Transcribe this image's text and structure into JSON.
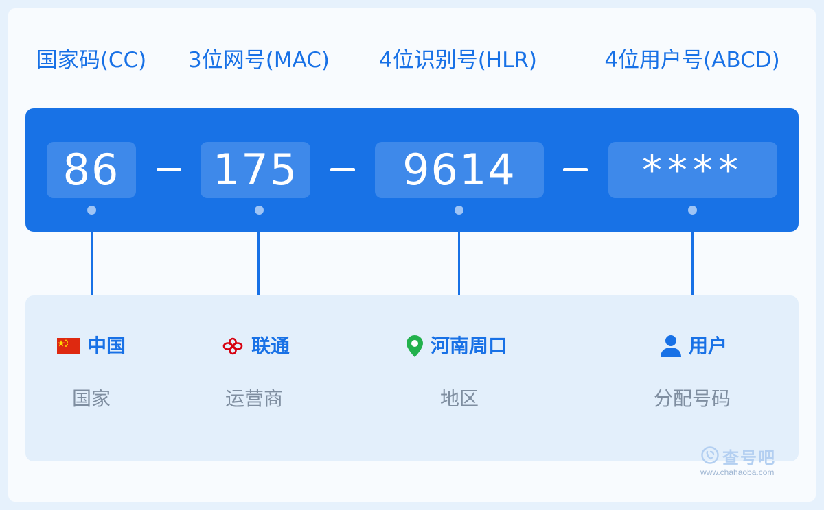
{
  "segments": [
    {
      "label": "国家码(CC)",
      "value": "86"
    },
    {
      "label": "3位网号(MAC)",
      "value": "175"
    },
    {
      "label": "4位识别号(HLR)",
      "value": "9614"
    },
    {
      "label": "4位用户号(ABCD)",
      "value": "****"
    }
  ],
  "details": [
    {
      "name": "中国",
      "caption": "国家",
      "icon": "china-flag-icon"
    },
    {
      "name": "联通",
      "caption": "运营商",
      "icon": "china-unicom-logo-icon"
    },
    {
      "name": "河南周口",
      "caption": "地区",
      "icon": "location-pin-icon"
    },
    {
      "name": "用户",
      "caption": "分配号码",
      "icon": "user-icon"
    }
  ],
  "watermark": {
    "title": "查号吧",
    "url": "www.chahaoba.com",
    "icon": "phone-search-icon"
  },
  "colors": {
    "accent": "#1872e6",
    "panel": "#e3effb",
    "caption": "#7f8ea0",
    "flag_red": "#de2910",
    "flag_yellow": "#ffde00",
    "unicom_red": "#d7000f",
    "pin_green": "#22b14c"
  }
}
